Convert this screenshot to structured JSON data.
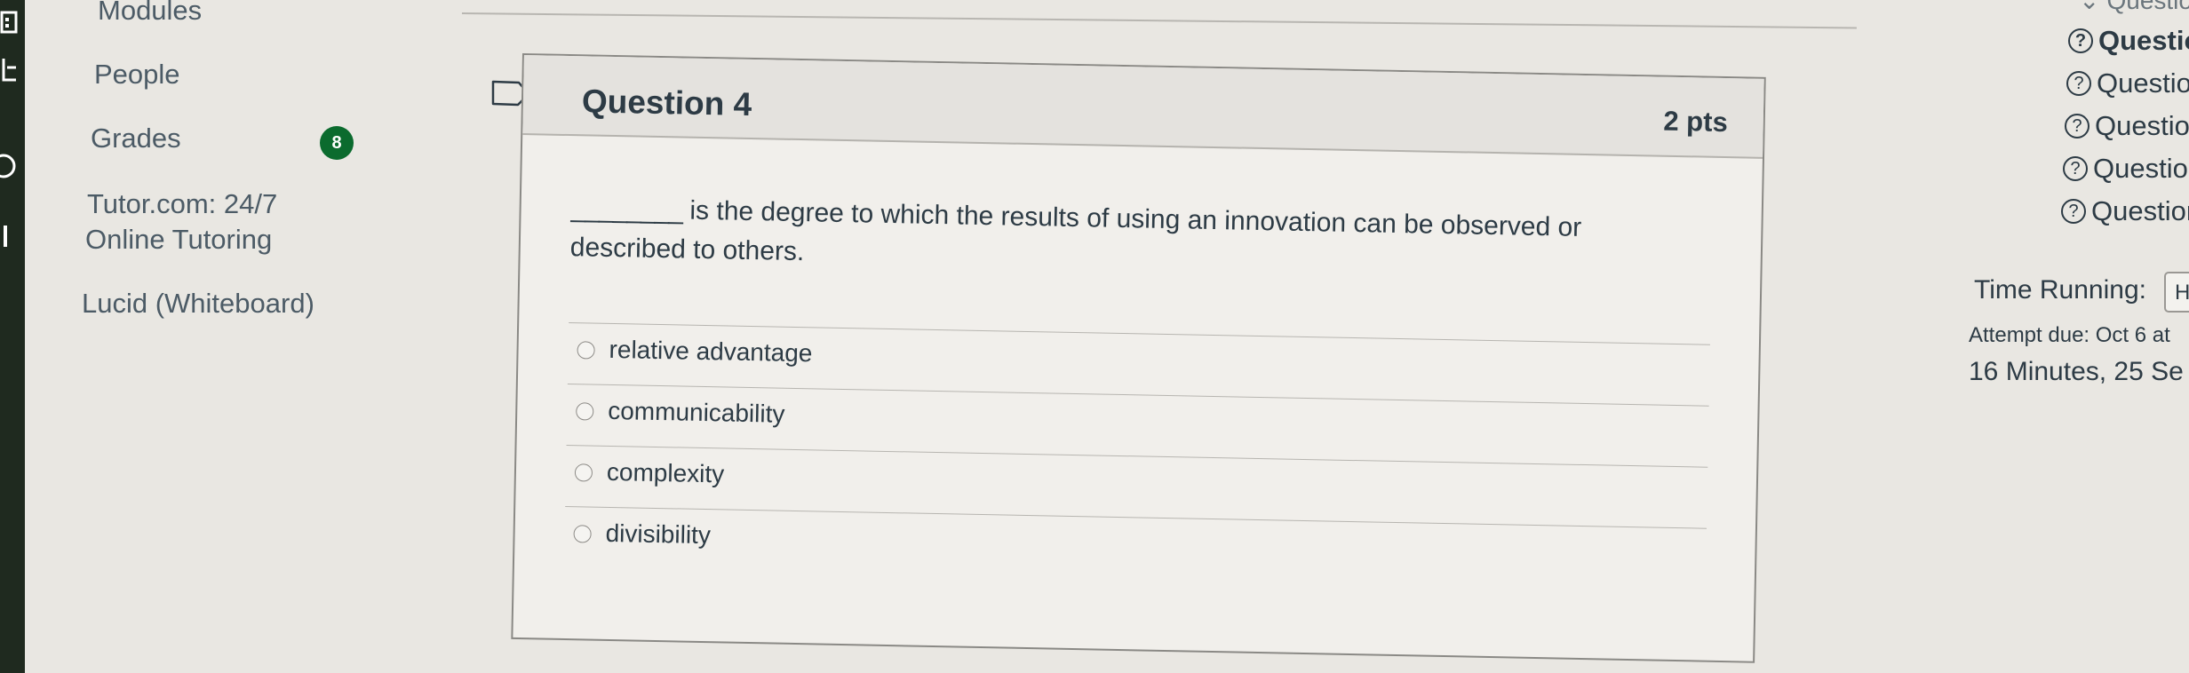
{
  "course_nav": {
    "items": [
      {
        "label": "Modules"
      },
      {
        "label": "People"
      },
      {
        "label": "Grades"
      },
      {
        "label": "Tutor.com: 24/7"
      },
      {
        "label": "Online Tutoring"
      },
      {
        "label": "Lucid (Whiteboard)"
      }
    ],
    "grades_badge": "8"
  },
  "question": {
    "title": "Question 4",
    "points": "2 pts",
    "blank": "________",
    "text_line1": " is the degree to which the results of using an innovation can be observed or",
    "text_line2": "described to others.",
    "answers": [
      {
        "label": "relative advantage"
      },
      {
        "label": "communicability"
      },
      {
        "label": "complexity"
      },
      {
        "label": "divisibility"
      }
    ]
  },
  "sidebar": {
    "question_links": [
      {
        "label": "Questior",
        "bold": true
      },
      {
        "label": "Questior"
      },
      {
        "label": "Questior"
      },
      {
        "label": "Questior"
      },
      {
        "label": "Questior"
      }
    ],
    "top_partial": "Questior",
    "timer_label": "Time Running:",
    "timer_button": "H",
    "attempt_due": "Attempt due: Oct 6 at",
    "elapsed": "16 Minutes, 25 Se"
  },
  "icons": {
    "flag": "flag-outline-icon",
    "question_mark": "question-circle-icon"
  },
  "colors": {
    "badge_green": "#0b6b2e",
    "global_nav_bg": "#1f2a1f",
    "text": "#2d3b45"
  }
}
